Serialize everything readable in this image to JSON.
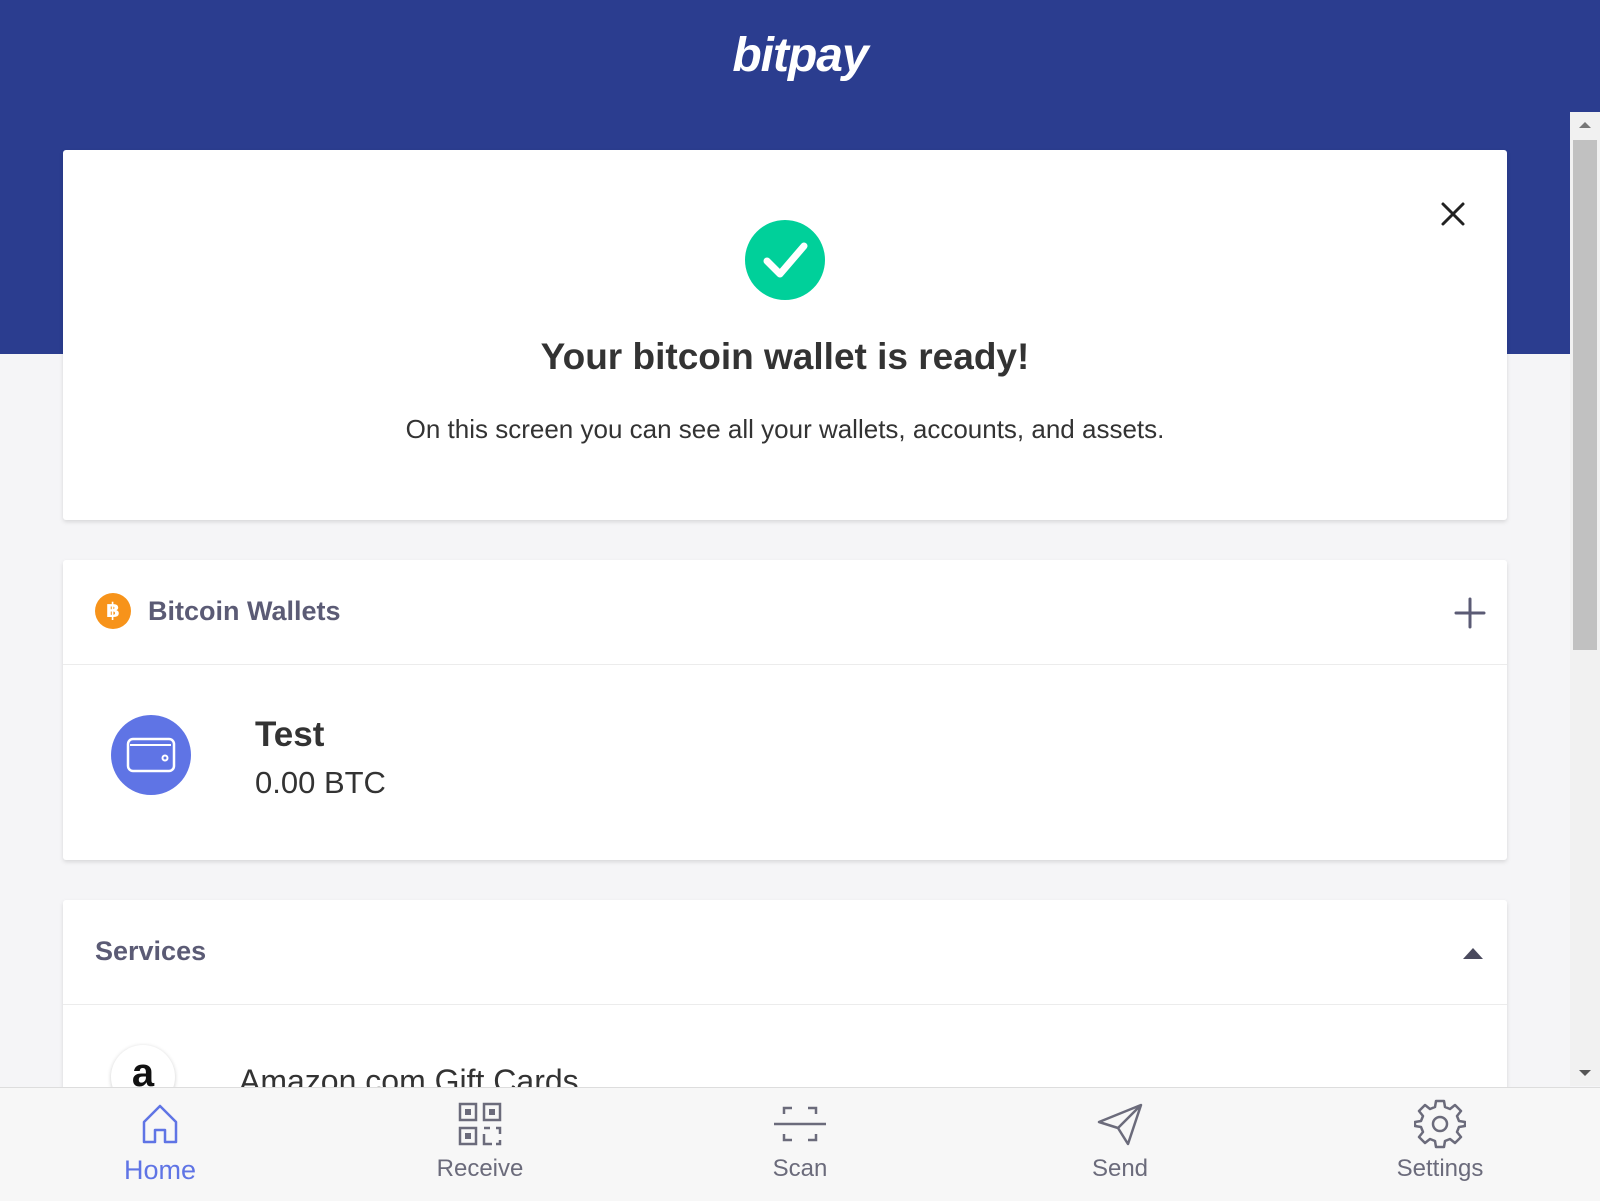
{
  "header": {
    "brand": "bitpay"
  },
  "welcome": {
    "title": "Your bitcoin wallet is ready!",
    "text": "On this screen you can see all your wallets, accounts, and assets."
  },
  "wallets_section": {
    "title": "Bitcoin Wallets",
    "coin_symbol": "฿",
    "items": [
      {
        "name": "Test",
        "balance": "0.00 BTC"
      }
    ]
  },
  "services_section": {
    "title": "Services",
    "items": [
      {
        "name": "Amazon.com Gift Cards",
        "logo": "a"
      }
    ]
  },
  "tabs": [
    {
      "label": "Home",
      "icon": "home-icon",
      "active": true
    },
    {
      "label": "Receive",
      "icon": "qr-code-icon"
    },
    {
      "label": "Scan",
      "icon": "scan-icon"
    },
    {
      "label": "Send",
      "icon": "paper-plane-icon"
    },
    {
      "label": "Settings",
      "icon": "gear-icon"
    }
  ],
  "colors": {
    "header": "#2b3d8f",
    "accent": "#5f74e5",
    "success": "#00d09a",
    "bitcoin": "#f7931a"
  }
}
